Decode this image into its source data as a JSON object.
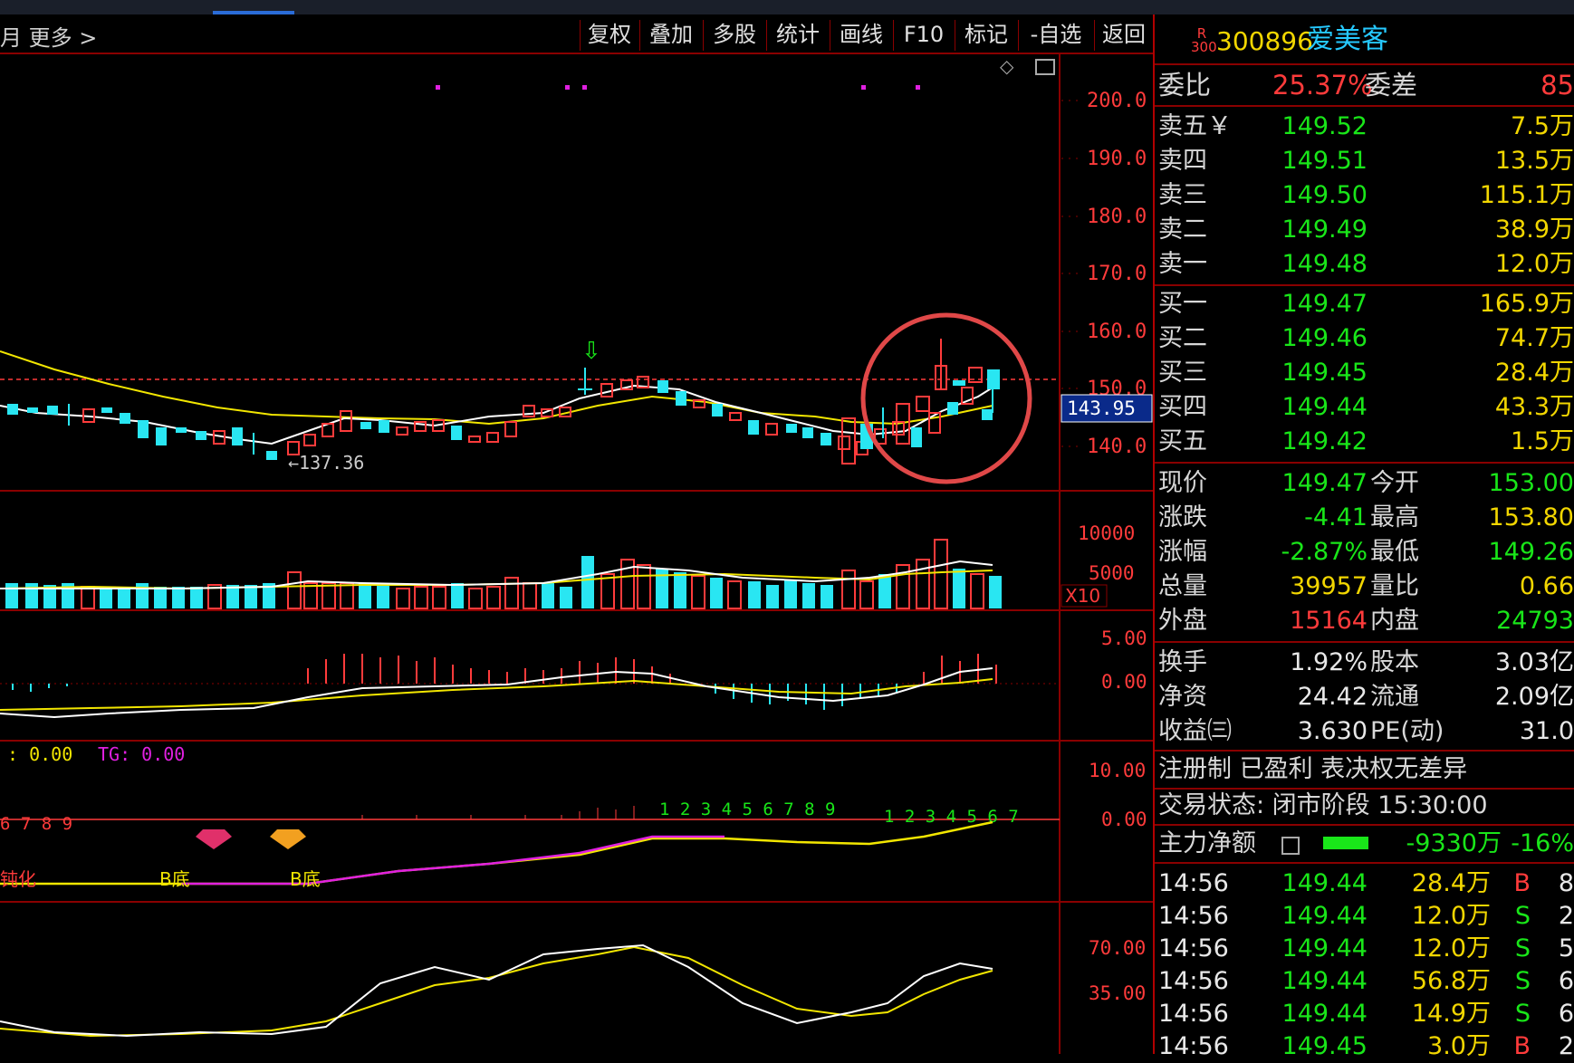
{
  "toolbar": {
    "left_text": "月  更多 >",
    "buttons": [
      "复权",
      "叠加",
      "多股",
      "统计",
      "画线",
      "F10",
      "标记",
      "-自选",
      "返回"
    ]
  },
  "chart": {
    "price_axis": [
      "200.0",
      "190.0",
      "180.0",
      "170.0",
      "160.0",
      "150.0",
      "140.0"
    ],
    "current_price_tag": "143.95",
    "low_marker": "←137.36",
    "volume_axis": [
      "10000",
      "5000"
    ],
    "volume_unit": "X10",
    "macd_axis": [
      "5.00",
      "0.00"
    ],
    "indicator_header": {
      "a": ": 0.00",
      "b": "TG: 0.00"
    },
    "indicator_axis": [
      "10.00",
      "0.00"
    ],
    "count_left": "6 7 8 9",
    "count_mid": "1 2 3 4 5 6 7 8 9",
    "count_right": "1 2 3 4 5 6 7",
    "label_left": "钝化",
    "label_b1": "B底",
    "label_b2": "B底",
    "kdj_axis": [
      "70.00",
      "35.00"
    ],
    "colors": {
      "up": "#ff3b3b",
      "down": "#29e6f2",
      "ma5": "#ffffff",
      "ma10": "#f2e600",
      "grid": "#8a0000"
    }
  },
  "quote": {
    "badge_top": "R",
    "badge_bottom": "300",
    "code": "300896",
    "name": "爱美客",
    "weibi_label": "委比",
    "weibi_value": "25.37%",
    "weicha_label": "委差",
    "weicha_value": "85",
    "sells": [
      {
        "label": "卖五￥",
        "price": "149.52",
        "vol": "7.5万"
      },
      {
        "label": "卖四",
        "price": "149.51",
        "vol": "13.5万"
      },
      {
        "label": "卖三",
        "price": "149.50",
        "vol": "115.1万"
      },
      {
        "label": "卖二",
        "price": "149.49",
        "vol": "38.9万"
      },
      {
        "label": "卖一",
        "price": "149.48",
        "vol": "12.0万"
      }
    ],
    "buys": [
      {
        "label": "买一",
        "price": "149.47",
        "vol": "165.9万"
      },
      {
        "label": "买二",
        "price": "149.46",
        "vol": "74.7万"
      },
      {
        "label": "买三",
        "price": "149.45",
        "vol": "28.4万"
      },
      {
        "label": "买四",
        "price": "149.44",
        "vol": "43.3万"
      },
      {
        "label": "买五",
        "price": "149.42",
        "vol": "1.5万"
      }
    ],
    "stats": [
      {
        "l1": "现价",
        "v1": "149.47",
        "l2": "今开",
        "v2": "153.00"
      },
      {
        "l1": "涨跌",
        "v1": "-4.41",
        "l2": "最高",
        "v2": "153.80"
      },
      {
        "l1": "涨幅",
        "v1": "-2.87%",
        "l2": "最低",
        "v2": "149.26"
      },
      {
        "l1": "总量",
        "v1": "39957",
        "l2": "量比",
        "v2": "0.66"
      },
      {
        "l1": "外盘",
        "v1": "15164",
        "l2": "内盘",
        "v2": "24793"
      }
    ],
    "fund": [
      {
        "l1": "换手",
        "v1": "1.92%",
        "l2": "股本",
        "v2": "3.03亿"
      },
      {
        "l1": "净资",
        "v1": "24.42",
        "l2": "流通",
        "v2": "2.09亿"
      },
      {
        "l1": "收益㈢",
        "v1": "3.630",
        "l2": "PE(动)",
        "v2": "31.0"
      }
    ],
    "tags": "注册制 已盈利 表决权无差异",
    "status": "交易状态: 闭市阶段 15:30:00",
    "mainflow_label": "主力净额",
    "mainflow_value": "-9330万",
    "mainflow_pct": "-16%",
    "ticks": [
      {
        "time": "14:56",
        "price": "149.44",
        "vol": "28.4万",
        "side": "B",
        "n": "8"
      },
      {
        "time": "14:56",
        "price": "149.44",
        "vol": "12.0万",
        "side": "S",
        "n": "2"
      },
      {
        "time": "14:56",
        "price": "149.44",
        "vol": "12.0万",
        "side": "S",
        "n": "5"
      },
      {
        "time": "14:56",
        "price": "149.44",
        "vol": "56.8万",
        "side": "S",
        "n": "6"
      },
      {
        "time": "14:56",
        "price": "149.44",
        "vol": "14.9万",
        "side": "S",
        "n": "6"
      },
      {
        "time": "14:56",
        "price": "149.45",
        "vol": "3.0万",
        "side": "B",
        "n": "2"
      }
    ]
  }
}
